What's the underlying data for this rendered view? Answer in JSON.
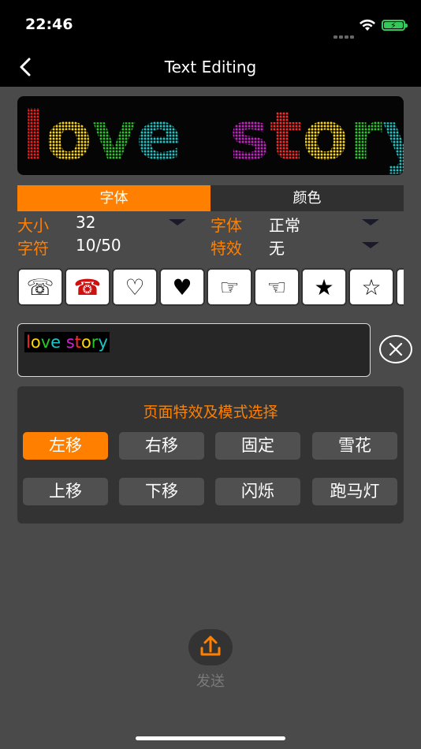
{
  "status_bar": {
    "time": "22:46"
  },
  "nav": {
    "title": "Text Editing"
  },
  "preview": {
    "letters": [
      {
        "ch": "l",
        "color": "#ff1a1a"
      },
      {
        "ch": "o",
        "color": "#ffd800"
      },
      {
        "ch": "v",
        "color": "#29c72a"
      },
      {
        "ch": "e",
        "color": "#18c7c7"
      },
      {
        "ch": " ",
        "color": "#000000"
      },
      {
        "ch": "s",
        "color": "#cc22cc"
      },
      {
        "ch": "t",
        "color": "#ff2a2a"
      },
      {
        "ch": "o",
        "color": "#ffd800"
      },
      {
        "ch": "r",
        "color": "#29c72a"
      },
      {
        "ch": "y",
        "color": "#18c7c7"
      }
    ]
  },
  "tabs": {
    "font": "字体",
    "color": "颜色"
  },
  "options": {
    "size_label": "大小",
    "size_value": "32",
    "font_label": "字体",
    "font_value": "正常",
    "chars_label": "字符",
    "chars_value": "10/50",
    "effect_label": "特效",
    "effect_value": "无"
  },
  "symbols": [
    "☏",
    "☎",
    "♡",
    "♥",
    "☞",
    "☜",
    "★",
    "☆",
    ""
  ],
  "text_input": {
    "letters": [
      {
        "ch": "l",
        "color": "#ff2020"
      },
      {
        "ch": "o",
        "color": "#ffd800"
      },
      {
        "ch": "v",
        "color": "#29c72a"
      },
      {
        "ch": "e",
        "color": "#18c7c7"
      },
      {
        "ch": " ",
        "color": "#ffffff"
      },
      {
        "ch": "s",
        "color": "#cc22cc"
      },
      {
        "ch": "t",
        "color": "#ff2a2a"
      },
      {
        "ch": "o",
        "color": "#ffd800"
      },
      {
        "ch": "r",
        "color": "#29c72a"
      },
      {
        "ch": "y",
        "color": "#18c7c7"
      }
    ]
  },
  "effects": {
    "title": "页面特效及模式选择",
    "buttons": [
      "左移",
      "右移",
      "固定",
      "雪花",
      "上移",
      "下移",
      "闪烁",
      "跑马灯"
    ],
    "active": "左移"
  },
  "send": {
    "label": "发送"
  },
  "colors": {
    "accent": "#ff8000",
    "background": "#4a4a4a",
    "panel": "#333333"
  }
}
